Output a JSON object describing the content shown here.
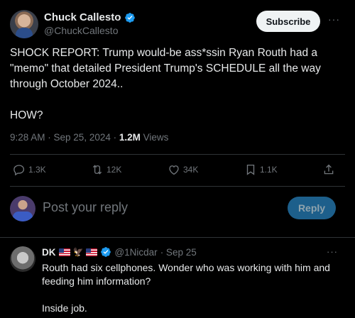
{
  "post": {
    "author_name": "Chuck Callesto",
    "author_handle": "@ChuckCallesto",
    "subscribe_label": "Subscribe",
    "more_label": "···",
    "text": "SHOCK REPORT: Trump would-be ass*ssin Ryan Routh had a \"memo\" that detailed President Trump's SCHEDULE all the way through October 2024..\n\nHOW?",
    "time": "9:28 AM · Sep 25, 2024 · ",
    "views_count": "1.2M",
    "views_label": " Views",
    "verified_color": "#1d9bf0"
  },
  "actions": {
    "replies": "1.3K",
    "reposts": "12K",
    "likes": "34K",
    "bookmarks": "1.1K"
  },
  "icons": [
    "reply-icon",
    "repost-icon",
    "like-icon",
    "bookmark-icon",
    "share-icon",
    "verified-badge-icon"
  ],
  "reply_box": {
    "placeholder": "Post your reply",
    "button_label": "Reply"
  },
  "comment": {
    "name": "DK",
    "handle": "@1Nicdar",
    "date": "· Sep 25",
    "more_label": "···",
    "text": "Routh had six cellphones. Wonder who was working with him and feeding him information?\n\nInside job."
  }
}
